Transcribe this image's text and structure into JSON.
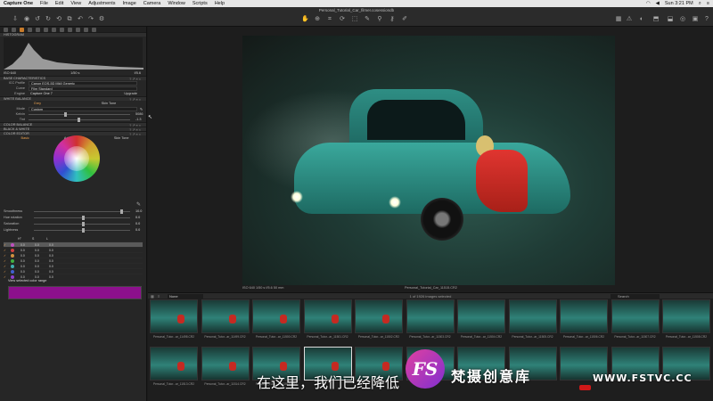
{
  "menubar": {
    "app": "Capture One",
    "items": [
      "File",
      "Edit",
      "View",
      "Adjustments",
      "Image",
      "Camera",
      "Window",
      "Scripts",
      "Help"
    ],
    "clock": "Sun 3:21 PM"
  },
  "toolbar": {
    "title": "Personal_Tutorial_Car_filmer.cosessiondb"
  },
  "left": {
    "histogram": {
      "title": "HISTOGRAM",
      "iso": "ISO 640",
      "shutter": "1/50 s",
      "aperture": "f/5.6"
    },
    "base_char": {
      "title": "BASE CHARACTERISTICS",
      "icc_label": "ICC Profile",
      "icc_value": "Canon EOS-5D MkII Generic",
      "curve_label": "Curve",
      "curve_value": "Film Standard",
      "engine_label": "Engine",
      "engine_value": "Capture One 7",
      "upgrade": "Upgrade"
    },
    "white_balance": {
      "title": "WHITE BALANCE",
      "tab1": "Grey",
      "tab2": "Skin Tone",
      "mode_label": "Mode",
      "mode_value": "Custom",
      "kelvin_label": "Kelvin",
      "kelvin_value": "5086",
      "tint_label": "Tint",
      "tint_value": "-1.3"
    },
    "color_balance": "COLOR BALANCE",
    "bw": "BLACK & WHITE",
    "color_editor": {
      "title": "COLOR EDITOR",
      "tabs": [
        "Basic",
        "Advanced",
        "Skin Tone"
      ],
      "sliders": [
        {
          "label": "Smoothness",
          "value": "10.0",
          "pos": 0.9
        },
        {
          "label": "Hue rotation",
          "value": "0.0",
          "pos": 0.5
        },
        {
          "label": "Saturation",
          "value": "0.0",
          "pos": 0.5
        },
        {
          "label": "Lightness",
          "value": "0.0",
          "pos": 0.5
        }
      ],
      "table_headers": [
        "",
        "H°",
        "S",
        "L"
      ],
      "rows": [
        {
          "color": "#c050c0",
          "h": "0.0",
          "s": "0.0",
          "l": "0.0",
          "selected": true
        },
        {
          "color": "#d04040",
          "h": "0.0",
          "s": "0.0",
          "l": "0.0"
        },
        {
          "color": "#d09040",
          "h": "0.0",
          "s": "0.0",
          "l": "0.0"
        },
        {
          "color": "#40b040",
          "h": "0.0",
          "s": "0.0",
          "l": "0.0"
        },
        {
          "color": "#40b0b0",
          "h": "0.0",
          "s": "0.0",
          "l": "0.0"
        },
        {
          "color": "#4060d0",
          "h": "0.0",
          "s": "0.0",
          "l": "0.0"
        },
        {
          "color": "#9040d0",
          "h": "0.0",
          "s": "0.0",
          "l": "0.0"
        }
      ],
      "view_range": "View selected color range",
      "swatch_color": "#8c108c"
    }
  },
  "viewer": {
    "left_caption": "ISO 640    1/50 s    f/5.6    50 mm",
    "right_caption": "Personal_Tutorial_Car_11515.CR2"
  },
  "browser": {
    "album": "None",
    "selection": "1 of 1926 images selected",
    "search": "Search",
    "labels_row1": [
      "Personal_Tutor...ar_11498.CR2",
      "Personal_Tutor...ar_11499.CR2",
      "Personal_Tutor...ar_11500.CR2",
      "Personal_Tutor...ar_11501.CR2",
      "Personal_Tutor...ar_11502.CR2",
      "Personal_Tutor...ar_11503.CR2",
      "Personal_Tutor...ar_11504.CR2",
      "Personal_Tutor...ar_11505.CR2",
      "Personal_Tutor...ar_11506.CR2",
      "Personal_Tutor...ar_11507.CR2",
      "Personal_Tutor...ar_11508.CR2"
    ],
    "labels_row2": [
      "Personal_Tutor...ar_11513.CR2",
      "Personal_Tutor...ar_11514.CR2",
      "Personal_Tutor...ar_11515.CR2",
      "",
      "",
      "",
      "",
      "",
      "",
      "",
      ""
    ]
  },
  "overlay": {
    "subtitle": "在这里，我们已经降低",
    "logo": "FS",
    "brand_cn": "梵摄创意库",
    "brand_url": "WWW.FSTVC.CC"
  }
}
